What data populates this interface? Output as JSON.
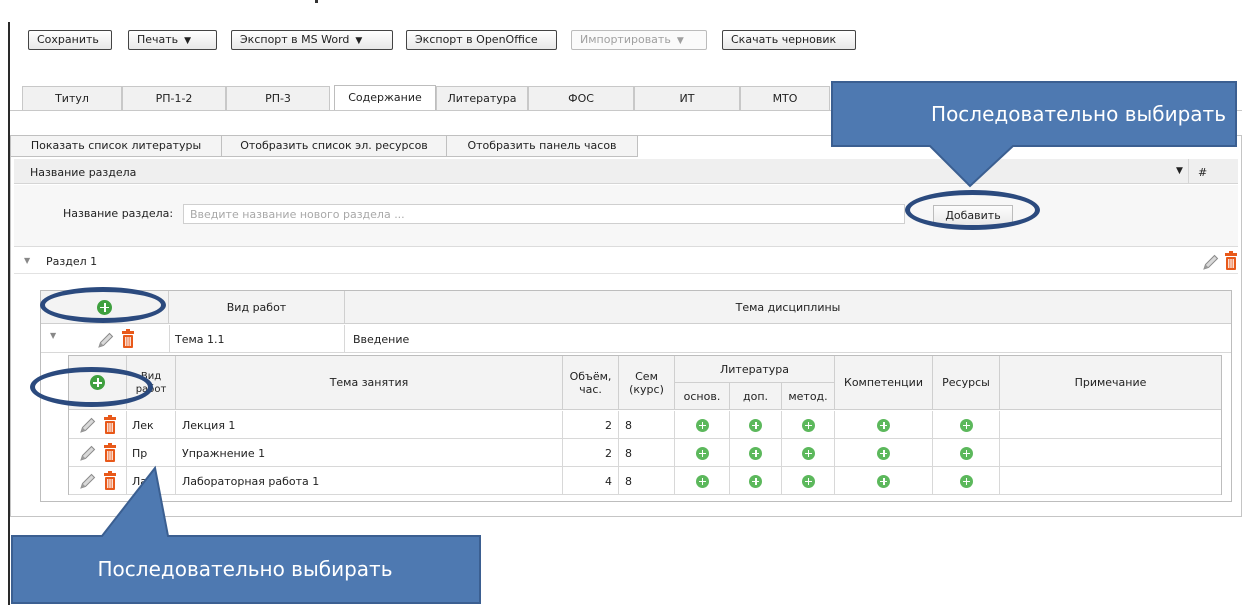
{
  "toolbar": {
    "save": "Сохранить",
    "print": "Печать",
    "export_word": "Экспорт в MS Word",
    "export_openoffice": "Экспорт в OpenOffice",
    "import": "Импортировать",
    "download_draft": "Скачать черновик"
  },
  "tabs": [
    "Титул",
    "РП-1-2",
    "РП-3",
    "Содержание",
    "Литература",
    "ФОС",
    "ИТ",
    "МТО"
  ],
  "active_tab": "Содержание",
  "subtabs": [
    "Показать список литературы",
    "Отобразить список эл. ресурсов",
    "Отобразить панель часов"
  ],
  "section_header": {
    "label": "Название раздела",
    "hash": "#"
  },
  "new_section": {
    "label": "Название раздела:",
    "placeholder": "Введите название нового раздела ...",
    "add_button": "Добавить"
  },
  "section": {
    "name": "Раздел 1"
  },
  "outer_table": {
    "headers": {
      "kind": "Вид работ",
      "topic": "Тема дисциплины"
    },
    "row": {
      "kind": "Тема 1.1",
      "topic": "Введение"
    }
  },
  "inner_table": {
    "headers": {
      "kind": "Вид работ",
      "topic": "Тема занятия",
      "volume": "Объём, час.",
      "sem": "Сем (курс)",
      "literature": "Литература",
      "lit_main": "основ.",
      "lit_add": "доп.",
      "lit_method": "метод.",
      "competencies": "Компетенции",
      "resources": "Ресурсы",
      "note": "Примечание"
    },
    "rows": [
      {
        "kind": "Лек",
        "topic": "Лекция 1",
        "volume": "2",
        "sem": "8"
      },
      {
        "kind": "Пр",
        "topic": "Упражнение 1",
        "volume": "2",
        "sem": "8"
      },
      {
        "kind": "Лаб",
        "topic": "Лабораторная работа 1",
        "volume": "4",
        "sem": "8"
      }
    ]
  },
  "annotations": {
    "top": "Последовательно выбирать",
    "bottom": "Последовательно выбирать"
  },
  "colors": {
    "callout": "#4e79b1",
    "ellipse": "#2b4a7e",
    "add_icon": "#5cb85c",
    "trash": "#e8591a"
  }
}
